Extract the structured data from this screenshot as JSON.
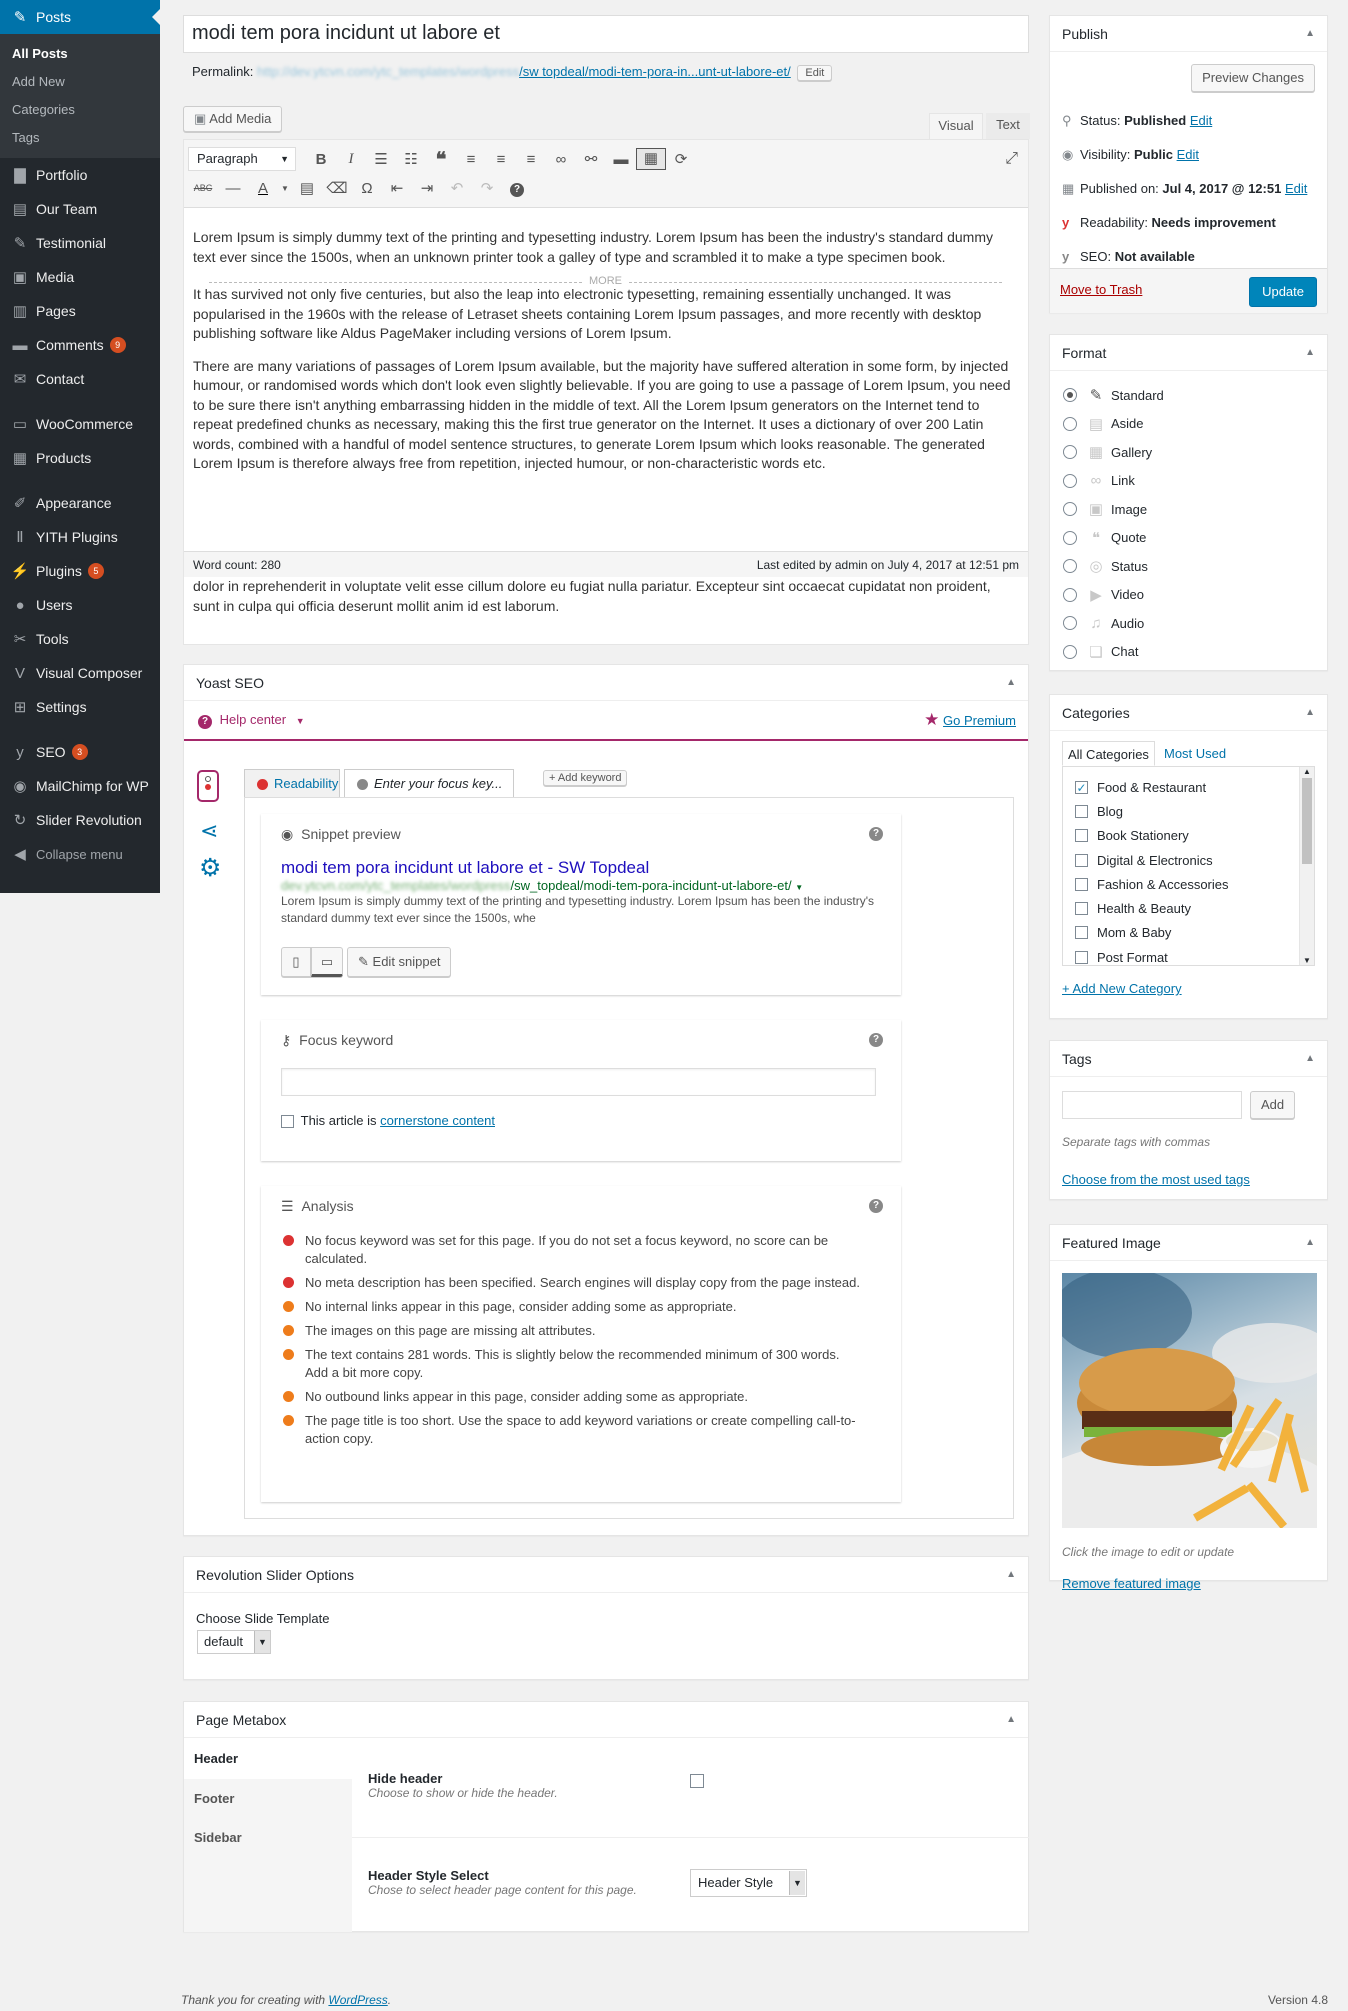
{
  "menu": {
    "posts": "Posts",
    "submenu": [
      "All Posts",
      "Add New",
      "Categories",
      "Tags"
    ],
    "group1": [
      {
        "label": "Portfolio",
        "icon": "portfolio-icon",
        "glyph": "▇"
      },
      {
        "label": "Our Team",
        "icon": "team-icon",
        "glyph": "▤"
      },
      {
        "label": "Testimonial",
        "icon": "testimonial-icon",
        "glyph": "✎"
      },
      {
        "label": "Media",
        "icon": "media-icon",
        "glyph": "▣"
      },
      {
        "label": "Pages",
        "icon": "pages-icon",
        "glyph": "▥"
      },
      {
        "label": "Comments",
        "icon": "comments-icon",
        "glyph": "▬",
        "badge": "9"
      },
      {
        "label": "Contact",
        "icon": "contact-icon",
        "glyph": "✉"
      }
    ],
    "group2": [
      {
        "label": "WooCommerce",
        "icon": "woocommerce-icon",
        "glyph": "▭"
      },
      {
        "label": "Products",
        "icon": "products-icon",
        "glyph": "▦"
      }
    ],
    "group3": [
      {
        "label": "Appearance",
        "icon": "appearance-icon",
        "glyph": "✐"
      },
      {
        "label": "YITH Plugins",
        "icon": "yith-icon",
        "glyph": "Ⅱ"
      },
      {
        "label": "Plugins",
        "icon": "plugins-icon",
        "glyph": "⚡",
        "badge": "5"
      },
      {
        "label": "Users",
        "icon": "users-icon",
        "glyph": "●"
      },
      {
        "label": "Tools",
        "icon": "tools-icon",
        "glyph": "✂"
      },
      {
        "label": "Visual Composer",
        "icon": "visual-composer-icon",
        "glyph": "V"
      },
      {
        "label": "Settings",
        "icon": "settings-icon",
        "glyph": "⊞"
      }
    ],
    "group4": [
      {
        "label": "SEO",
        "icon": "seo-icon",
        "glyph": "y",
        "badge": "3"
      },
      {
        "label": "MailChimp for WP",
        "icon": "mailchimp-icon",
        "glyph": "◉"
      },
      {
        "label": "Slider Revolution",
        "icon": "slider-revolution-icon",
        "glyph": "↻"
      },
      {
        "label": "Collapse menu",
        "icon": "collapse-icon",
        "glyph": "◀"
      }
    ]
  },
  "post": {
    "title": "modi tem pora incidunt ut labore et",
    "permalink_label": "Permalink:",
    "permalink_blur": "http://dev.ytcvn.com/ytc_templates/wordpress",
    "permalink_tail": "/sw topdeal/modi-tem-pora-in...unt-ut-labore-et/",
    "edit": "Edit"
  },
  "editor": {
    "add_media": "Add Media",
    "tab_visual": "Visual",
    "tab_text": "Text",
    "format_select": "Paragraph",
    "p1": "Lorem Ipsum is simply dummy text of the printing and typesetting industry. Lorem Ipsum has been the industry's standard dummy text ever since the 1500s, when an unknown printer took a galley of type and scrambled it to make a type specimen book.",
    "more": "MORE",
    "p2": "It has survived not only five centuries, but also the leap into electronic typesetting, remaining essentially unchanged. It was popularised in the 1960s with the release of Letraset sheets containing Lorem Ipsum passages, and more recently with desktop publishing software like Aldus PageMaker including versions of Lorem Ipsum.",
    "p3": "There are many variations of passages of Lorem Ipsum available, but the majority have suffered alteration in some form, by injected humour, or randomised words which don't look even slightly believable. If you are going to use a passage of Lorem Ipsum, you need to be sure there isn't anything embarrassing hidden in the middle of text. All the Lorem Ipsum generators on the Internet tend to repeat predefined chunks as necessary, making this the first true generator on the Internet. It uses a dictionary of over 200 Latin words, combined with a handful of model sentence structures, to generate Lorem Ipsum which looks reasonable. The generated Lorem Ipsum is therefore always free from repetition, injected humour, or non-characteristic words etc.",
    "word_count": "Word count: 280",
    "last_edited": "Last edited by admin on July 4, 2017 at 12:51 pm",
    "overflow_text": "dolor in reprehenderit in voluptate velit esse cillum dolore eu fugiat nulla pariatur. Excepteur sint occaecat cupidatat non proident, sunt in culpa qui officia deserunt mollit anim id est laborum."
  },
  "yoast": {
    "title": "Yoast SEO",
    "help_center": "Help center",
    "go_premium": "Go Premium",
    "tab_readability": "Readability",
    "tab_keyword": "Enter your focus key...",
    "add_keyword": "+ Add keyword",
    "snippet_title": "Snippet preview",
    "snippet_link": "modi tem pora incidunt ut labore et - SW Topdeal",
    "snippet_url_blur": "dev.ytcvn.com/ytc_templates/wordpress",
    "snippet_url_tail": "/sw_topdeal/modi-tem-pora-incidunt-ut-labore-et/",
    "snippet_desc": "Lorem Ipsum is simply dummy text of the printing and typesetting industry. Lorem Ipsum has been the industry's standard dummy text ever since the 1500s, whe",
    "edit_snippet": "Edit snippet",
    "focus_title": "Focus keyword",
    "cornerstone_pre": "This article is ",
    "cornerstone_link": "cornerstone content",
    "analysis_title": "Analysis",
    "analysis": [
      {
        "color": "#dc3232",
        "text": "No focus keyword was set for this page. If you do not set a focus keyword, no score can be calculated."
      },
      {
        "color": "#dc3232",
        "text": "No meta description has been specified. Search engines will display copy from the page instead."
      },
      {
        "color": "#ee7c1b",
        "text": "No internal links appear in this page, consider adding some as appropriate."
      },
      {
        "color": "#ee7c1b",
        "text": "The images on this page are missing alt attributes."
      },
      {
        "color": "#ee7c1b",
        "text": "The text contains 281 words. This is slightly below the recommended minimum of 300 words. Add a bit more copy."
      },
      {
        "color": "#ee7c1b",
        "text": "No outbound links appear in this page, consider adding some as appropriate."
      },
      {
        "color": "#ee7c1b",
        "text": "The page title is too short. Use the space to add keyword variations or create compelling call-to-action copy."
      }
    ]
  },
  "revslider": {
    "title": "Revolution Slider Options",
    "label": "Choose Slide Template",
    "value": "default"
  },
  "pagemeta": {
    "title": "Page Metabox",
    "tabs": [
      "Header",
      "Footer",
      "Sidebar"
    ],
    "hide_header": "Hide header",
    "hide_header_desc": "Choose to show or hide the header.",
    "style_select": "Header Style Select",
    "style_select_desc": "Chose to select header page content for this page.",
    "style_value": "Header Style"
  },
  "publish": {
    "title": "Publish",
    "preview": "Preview Changes",
    "status_label": "Status: ",
    "status": "Published",
    "visibility_label": "Visibility: ",
    "visibility": "Public",
    "published_label": "Published on: ",
    "published": "Jul 4, 2017 @ 12:51",
    "readability_label": "Readability: ",
    "readability": "Needs improvement",
    "seo_label": "SEO: ",
    "seo": "Not available",
    "edit": "Edit",
    "trash": "Move to Trash",
    "update": "Update"
  },
  "format": {
    "title": "Format",
    "options": [
      {
        "label": "Standard",
        "icon": "pin-icon",
        "glyph": "✎",
        "checked": true
      },
      {
        "label": "Aside",
        "icon": "aside-icon",
        "glyph": "▤"
      },
      {
        "label": "Gallery",
        "icon": "gallery-icon",
        "glyph": "▦"
      },
      {
        "label": "Link",
        "icon": "link-icon",
        "glyph": "∞"
      },
      {
        "label": "Image",
        "icon": "image-icon",
        "glyph": "▣"
      },
      {
        "label": "Quote",
        "icon": "quote-icon",
        "glyph": "❝"
      },
      {
        "label": "Status",
        "icon": "status-icon",
        "glyph": "◎"
      },
      {
        "label": "Video",
        "icon": "video-icon",
        "glyph": "▶"
      },
      {
        "label": "Audio",
        "icon": "audio-icon",
        "glyph": "♫"
      },
      {
        "label": "Chat",
        "icon": "chat-icon",
        "glyph": "❏"
      }
    ]
  },
  "categories": {
    "title": "Categories",
    "tab_all": "All Categories",
    "tab_used": "Most Used",
    "items": [
      {
        "label": "Food & Restaurant",
        "checked": true
      },
      {
        "label": "Blog"
      },
      {
        "label": "Book Stationery"
      },
      {
        "label": "Digital & Electronics"
      },
      {
        "label": "Fashion & Accessories"
      },
      {
        "label": "Health & Beauty"
      },
      {
        "label": "Mom & Baby"
      },
      {
        "label": "Post Format"
      }
    ],
    "add_new": "+ Add New Category"
  },
  "tags": {
    "title": "Tags",
    "add": "Add",
    "hint": "Separate tags with commas",
    "choose": "Choose from the most used tags"
  },
  "featured": {
    "title": "Featured Image",
    "hint": "Click the image to edit or update",
    "remove": "Remove featured image"
  },
  "footer": {
    "thanks_pre": "Thank you for creating with ",
    "thanks_link": "WordPress",
    "thanks_post": ".",
    "version": "Version 4.8"
  },
  "colors": {
    "primary": "#0073aa",
    "sidebar": "#23282d",
    "yoast": "#a4286a"
  }
}
